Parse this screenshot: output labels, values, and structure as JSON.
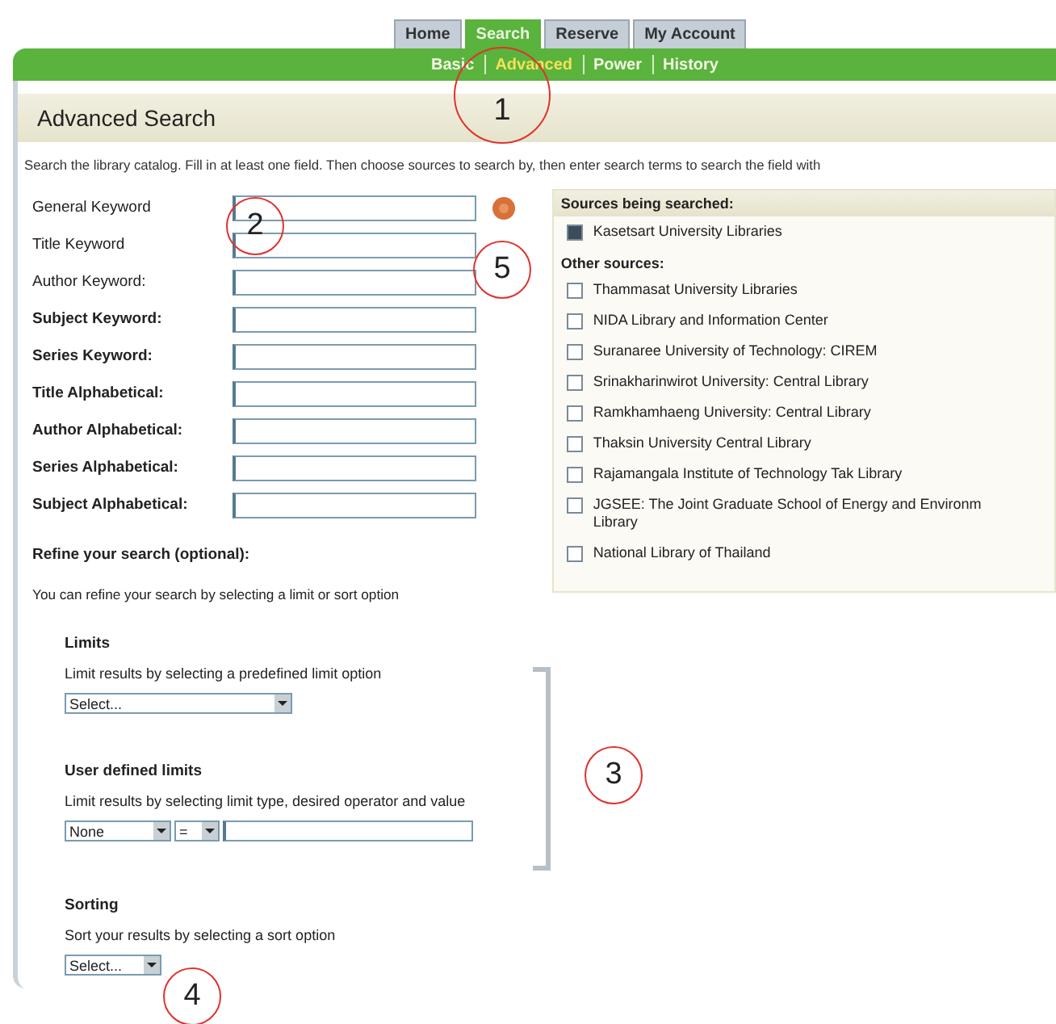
{
  "tabs": [
    {
      "label": "Home",
      "selected": false
    },
    {
      "label": "Search",
      "selected": true
    },
    {
      "label": "Reserve",
      "selected": false
    },
    {
      "label": "My Account",
      "selected": false
    }
  ],
  "subnav": [
    {
      "label": "Basic",
      "selected": false
    },
    {
      "label": "Advanced",
      "selected": true
    },
    {
      "label": "Power",
      "selected": false
    },
    {
      "label": "History",
      "selected": false
    }
  ],
  "page_title": "Advanced Search",
  "intro": "Search the library catalog. Fill in at least one field. Then choose sources to search by, then enter search terms to search the field with",
  "fields": [
    {
      "label": "General Keyword",
      "bold": false
    },
    {
      "label": "Title Keyword",
      "bold": false
    },
    {
      "label": "Author Keyword:",
      "bold": false
    },
    {
      "label": "Subject Keyword:",
      "bold": true
    },
    {
      "label": "Series Keyword:",
      "bold": true
    },
    {
      "label": "Title Alphabetical:",
      "bold": true
    },
    {
      "label": "Author Alphabetical:",
      "bold": true
    },
    {
      "label": "Series Alphabetical:",
      "bold": true
    },
    {
      "label": "Subject Alphabetical:",
      "bold": true
    }
  ],
  "refine": {
    "heading": "Refine your search (optional):",
    "text": "You can refine your search by selecting a limit or sort option",
    "limits": {
      "heading": "Limits",
      "text": "Limit results by selecting a predefined limit option",
      "select": "Select..."
    },
    "user_limits": {
      "heading": "User defined limits",
      "text": "Limit results by selecting limit type, desired operator and value",
      "type_select": "None",
      "operator_select": "="
    },
    "sorting": {
      "heading": "Sorting",
      "text": "Sort your results by selecting a sort option",
      "select": "Select..."
    }
  },
  "sources": {
    "heading": "Sources being searched:",
    "selected_sources": [
      {
        "label": "Kasetsart University Libraries",
        "checked": true
      }
    ],
    "other_heading": "Other sources:",
    "other_sources": [
      {
        "label": "Thammasat University Libraries",
        "checked": false
      },
      {
        "label": "NIDA Library and Information Center",
        "checked": false
      },
      {
        "label": "Suranaree University of Technology: CIREM",
        "checked": false
      },
      {
        "label": "Srinakharinwirot University: Central Library",
        "checked": false
      },
      {
        "label": "Ramkhamhaeng University: Central Library",
        "checked": false
      },
      {
        "label": "Thaksin University Central Library",
        "checked": false
      },
      {
        "label": "Rajamangala Institute of Technology Tak Library",
        "checked": false
      },
      {
        "label": "JGSEE: The Joint Graduate School of Energy and Environm Library",
        "checked": false
      },
      {
        "label": "National Library of Thailand",
        "checked": false
      }
    ]
  },
  "annotations": [
    "1",
    "2",
    "5",
    "3",
    "4"
  ]
}
